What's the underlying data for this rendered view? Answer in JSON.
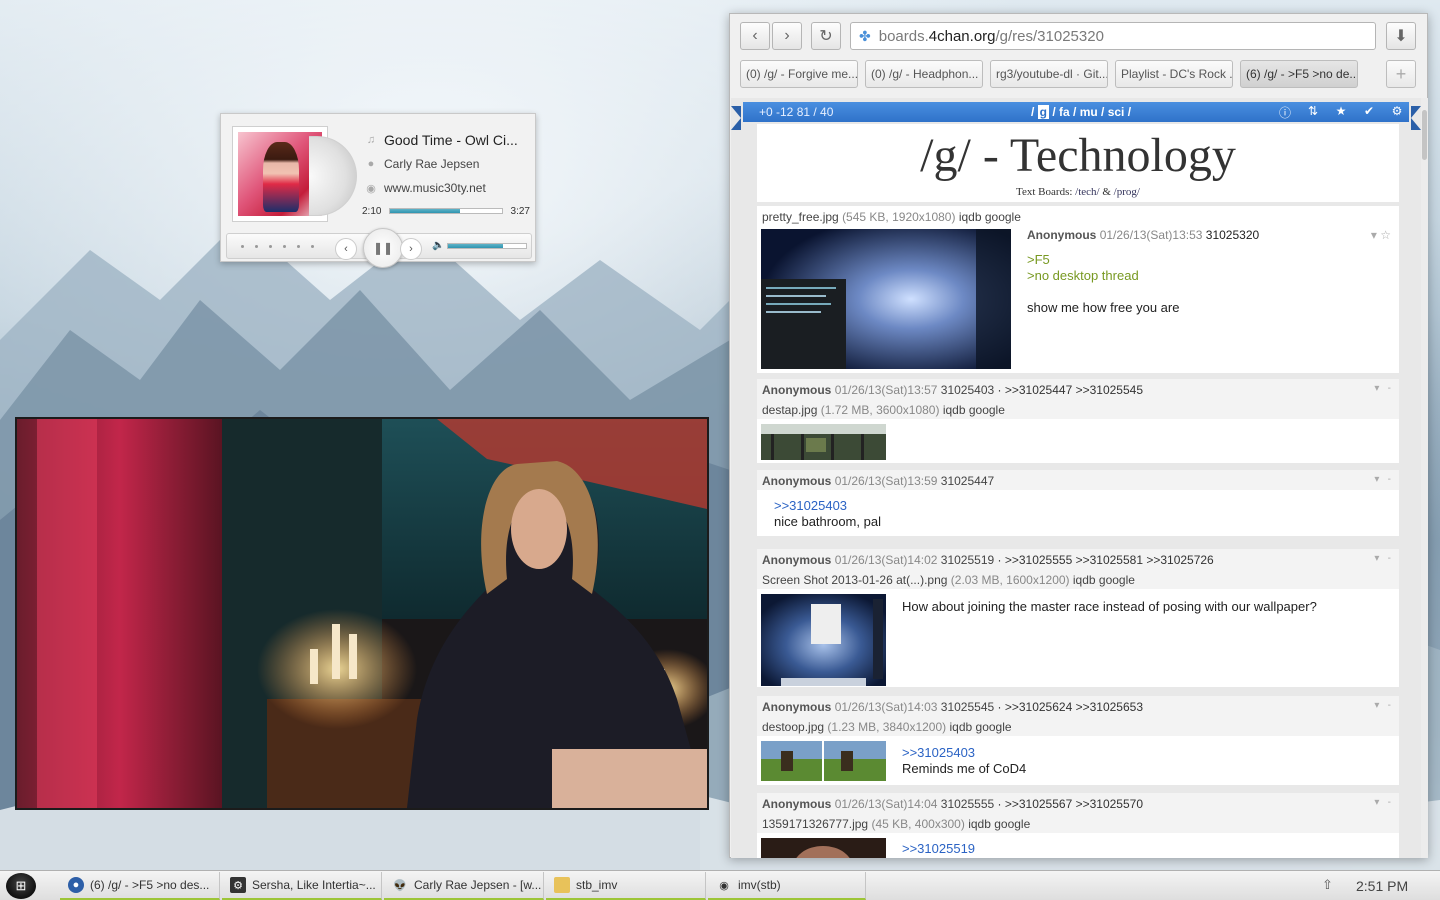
{
  "player": {
    "track_title": "Good Time - Owl Ci...",
    "artist": "Carly Rae Jepsen",
    "site": "www.music30ty.net",
    "elapsed": "2:10",
    "duration": "3:27",
    "progress": 0.63,
    "volume": 0.7,
    "icons": {
      "track": "music-note-icon",
      "artist": "person-icon",
      "site": "globe-icon"
    }
  },
  "browser": {
    "url_domain": "boards.4chan.org",
    "url_path": "/g/res/31025320",
    "url_prefix": "boards.",
    "url_host": "4chan.org",
    "tabs": [
      {
        "label": "(0) /g/ - Forgive me..."
      },
      {
        "label": "(0) /g/ - Headphon..."
      },
      {
        "label": "rg3/youtube-dl · Git..."
      },
      {
        "label": "Playlist - DC's Rock ..."
      },
      {
        "label": "(6) /g/ - >F5 >no de..."
      }
    ],
    "active_tab": 4
  },
  "board": {
    "stats": "+0 -12    81 / 40",
    "board_g": "g",
    "board_rest": " / fa / mu / sci /",
    "title": "/g/ - Technology",
    "text_boards_label": "Text Boards:",
    "tech_link": "/tech/",
    "amp": "&",
    "prog_link": "/prog/",
    "accent": "#2f72c9"
  },
  "posts": {
    "op": {
      "filename": "pretty_free.jpg",
      "filemeta": "(545 KB, 1920x1080)",
      "links": "iqdb google",
      "name": "Anonymous",
      "date": "01/26/13(Sat)13:53",
      "no": "31025320",
      "line1": ">F5",
      "line2": ">no desktop thread",
      "line3": "show me how free you are"
    },
    "p1": {
      "name": "Anonymous",
      "date": "01/26/13(Sat)13:57",
      "no": "31025403",
      "replies": ">>31025447 >>31025545",
      "filename": "destap.jpg",
      "filemeta": "(1.72 MB, 3600x1080)",
      "links": "iqdb google"
    },
    "p2": {
      "name": "Anonymous",
      "date": "01/26/13(Sat)13:59",
      "no": "31025447",
      "quote": ">>31025403",
      "text": "nice bathroom, pal"
    },
    "p3": {
      "name": "Anonymous",
      "date": "01/26/13(Sat)14:02",
      "no": "31025519",
      "replies": ">>31025555 >>31025581 >>31025726",
      "filename": "Screen Shot 2013-01-26 at(...).png",
      "filemeta": "(2.03 MB, 1600x1200)",
      "links": "iqdb google",
      "text": "How about joining the master race instead of posing with our wallpaper?"
    },
    "p4": {
      "name": "Anonymous",
      "date": "01/26/13(Sat)14:03",
      "no": "31025545",
      "replies": ">>31025624 >>31025653",
      "filename": "destoop.jpg",
      "filemeta": "(1.23 MB, 3840x1200)",
      "links": "iqdb google",
      "quote": ">>31025403",
      "text": "Reminds me of CoD4"
    },
    "p5": {
      "name": "Anonymous",
      "date": "01/26/13(Sat)14:04",
      "no": "31025555",
      "replies": ">>31025567 >>31025570",
      "filename": "1359171326777.jpg",
      "filemeta": "(45 KB, 400x300)",
      "links": "iqdb google",
      "quote": ">>31025519"
    }
  },
  "taskbar": {
    "items": [
      {
        "label": "(6) /g/ - >F5 >no des...",
        "icon": "chrome-icon"
      },
      {
        "label": "Sersha, Like Intertia~...",
        "icon": "steam-icon"
      },
      {
        "label": "Carly Rae Jepsen - [w...",
        "icon": "alien-icon"
      },
      {
        "label": "stb_imv",
        "icon": "folder-icon"
      },
      {
        "label": "imv(stb)",
        "icon": "eye-icon"
      }
    ],
    "clock": "2:51 PM"
  }
}
